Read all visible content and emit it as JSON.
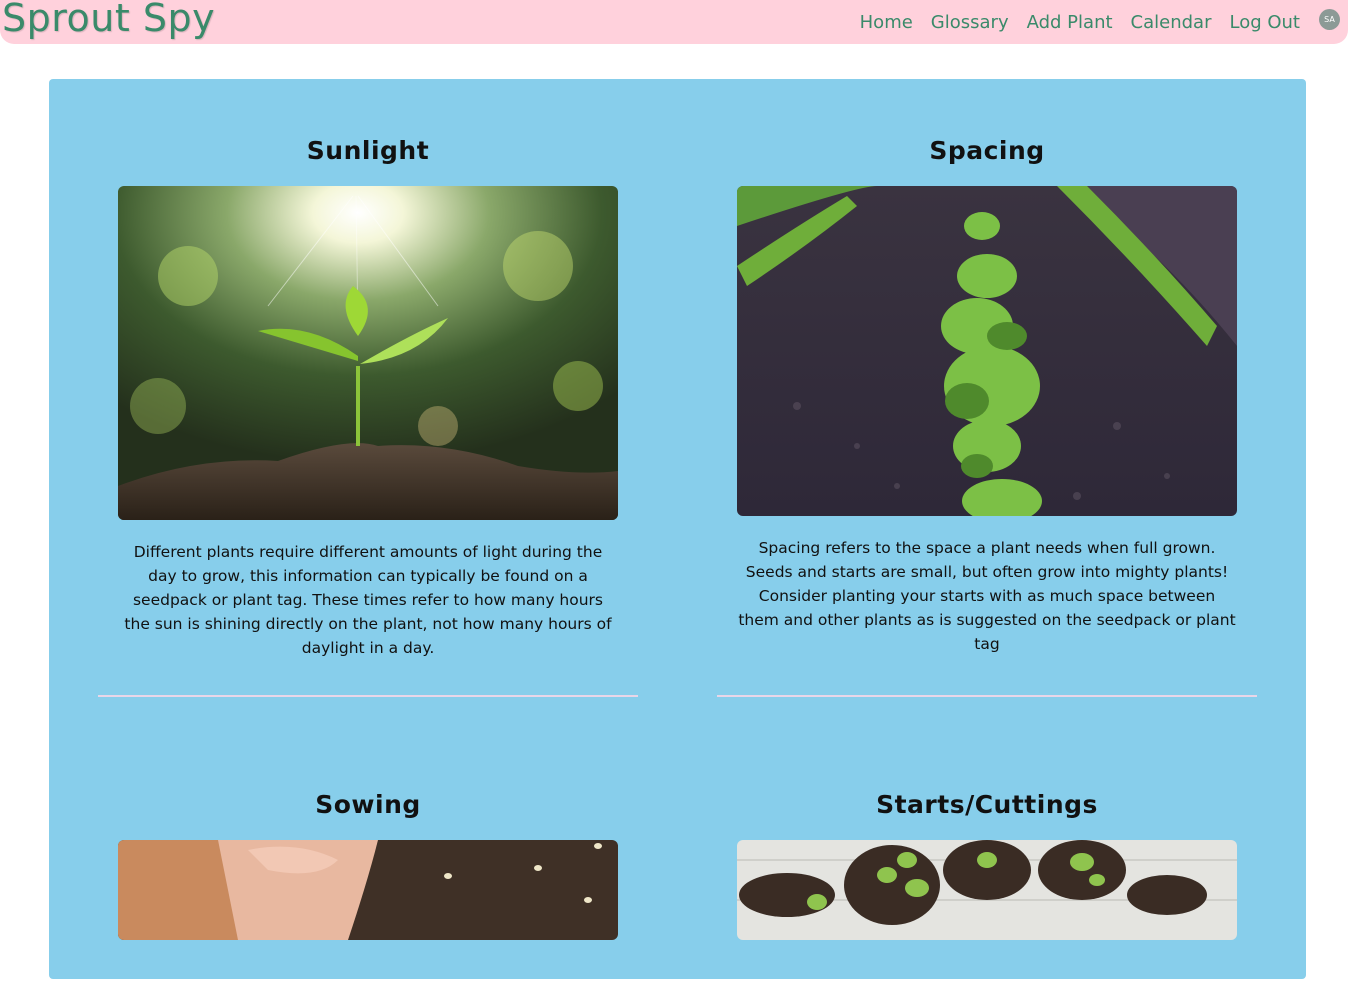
{
  "brand": "Sprout Spy",
  "nav": {
    "links": [
      "Home",
      "Glossary",
      "Add Plant",
      "Calendar",
      "Log Out"
    ],
    "avatar": "SA"
  },
  "cards": [
    {
      "title": "Sunlight",
      "image": "seedling-in-sunlight",
      "text": "Different plants require different amounts of light during the day to grow, this information can typically be found on a seedpack or plant tag. These times refer to how many hours the sun is shining directly on the plant, not how many hours of daylight in a day."
    },
    {
      "title": "Spacing",
      "image": "spaced-crop-rows",
      "text": "Spacing refers to the space a plant needs when full grown. Seeds and starts are small, but often grow into mighty plants! Consider planting your starts with as much space between them and other plants as is suggested on the seedpack or plant tag"
    },
    {
      "title": "Sowing",
      "image": "hand-sowing-seeds",
      "text": ""
    },
    {
      "title": "Starts/Cuttings",
      "image": "potted-seedlings",
      "text": ""
    }
  ],
  "colors": {
    "navbar": "#ffd1dc",
    "brand": "#3a8a6a",
    "panel": "#87ceeb",
    "divider": "#e8d6e8"
  }
}
